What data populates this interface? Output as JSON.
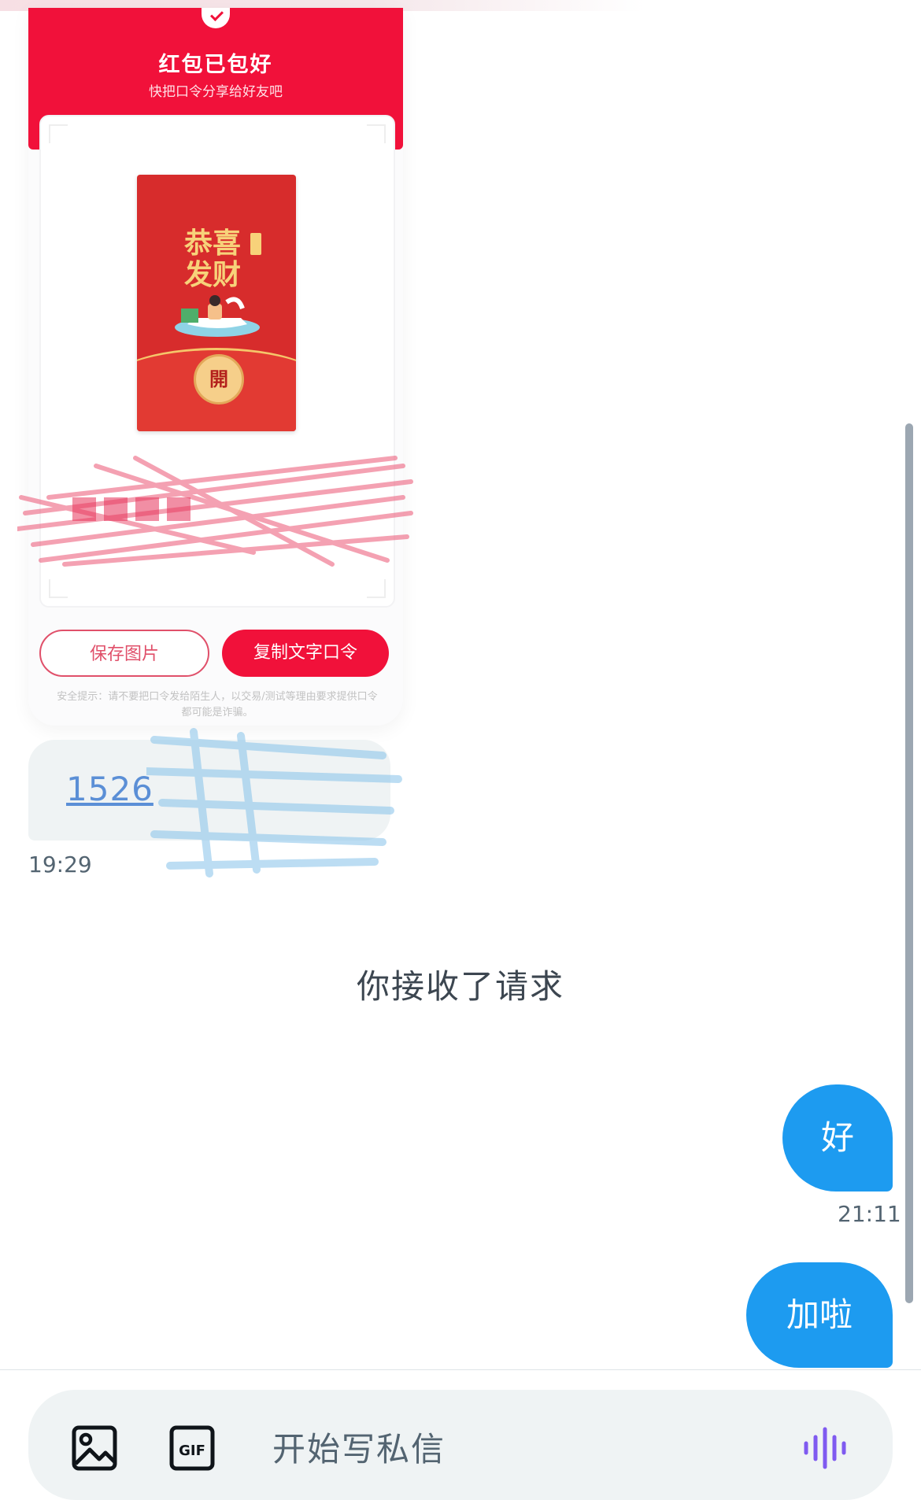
{
  "packet": {
    "title": "红包已包好",
    "subtitle": "快把口令分享给好友吧",
    "envelope_text": "恭喜发财",
    "open_char": "開",
    "save_button": "保存图片",
    "copy_button": "复制文字口令",
    "safety_note": "安全提示：请不要把口令发给陌生人，以交易/测试等理由要求提供口令都可能是诈骗。"
  },
  "messages": {
    "link_text": "1526",
    "incoming_time": "19:29",
    "system_text": "你接收了请求",
    "out1_text": "好",
    "out1_time": "21:11",
    "out2_text": "加啦"
  },
  "composer": {
    "placeholder": "开始写私信",
    "image_icon": "image-icon",
    "gif_icon": "gif-icon",
    "voice_icon": "voice-wave-icon"
  },
  "colors": {
    "accent": "#1d9bf0",
    "packet_red": "#f1113a",
    "muted_text": "#536471"
  }
}
